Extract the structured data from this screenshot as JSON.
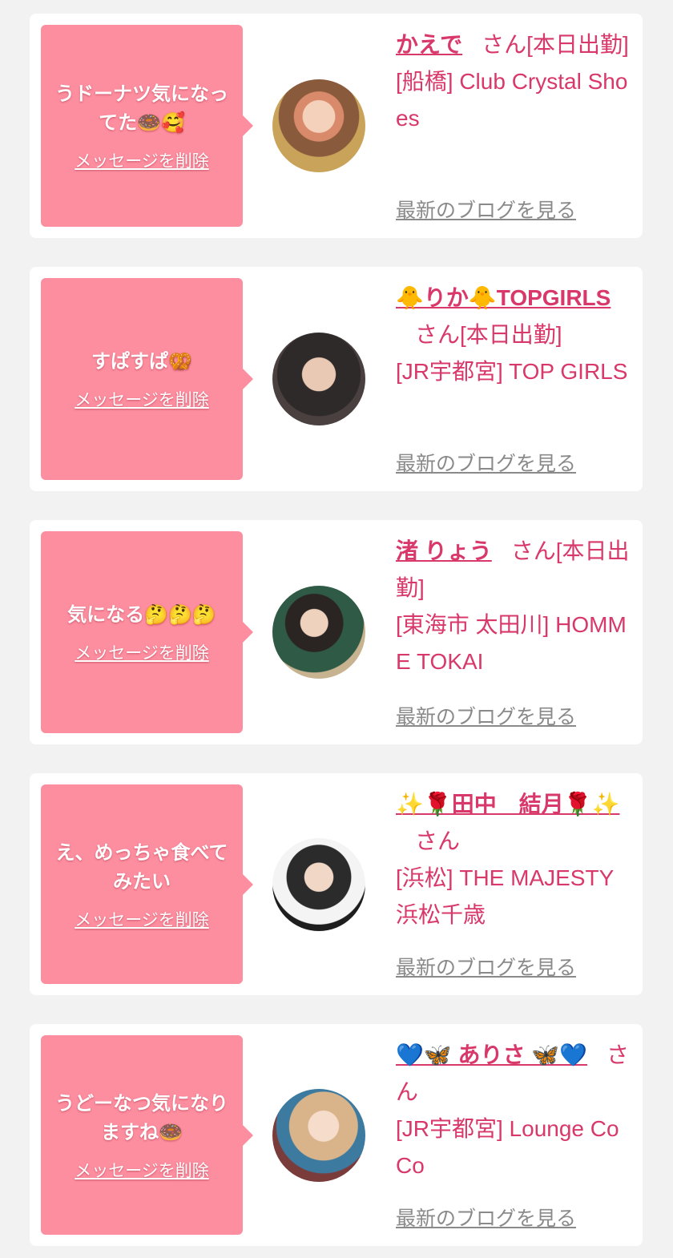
{
  "delete_label": "メッセージを削除",
  "blog_label": "最新のブログを見る",
  "colors": {
    "page_background": "#f2f2f2",
    "card_background": "#ffffff",
    "bubble_pink": "#fd8e9f",
    "name_pink": "#d8386a",
    "link_gray": "#8a8a8a"
  },
  "messages": [
    {
      "text": "うドーナツ気になってた🍩🥰",
      "name": "かえで",
      "suffix": "さん[本日出勤]",
      "shop": "[船橋] Club Crystal Shoes"
    },
    {
      "text": "すぱすぱ🥨",
      "name": "🐥りか🐥TOPGIRLS",
      "suffix": "さん[本日出勤]",
      "shop": "[JR宇都宮] TOP GIRLS"
    },
    {
      "text": "気になる🤔🤔🤔",
      "name": "渚 りょう",
      "suffix": "さん[本日出勤]",
      "shop": "[東海市 太田川] HOMME TOKAI"
    },
    {
      "text": "え、めっちゃ食べてみたい",
      "name": "✨🌹田中　結月🌹✨",
      "suffix": "さん",
      "shop": "[浜松] THE MAJESTY 浜松千歳"
    },
    {
      "text": "うどーなつ気になりますね🍩",
      "name": "💙🦋 ありさ 🦋💙",
      "suffix": "さん",
      "shop": "[JR宇都宮] Lounge CoCo"
    }
  ]
}
